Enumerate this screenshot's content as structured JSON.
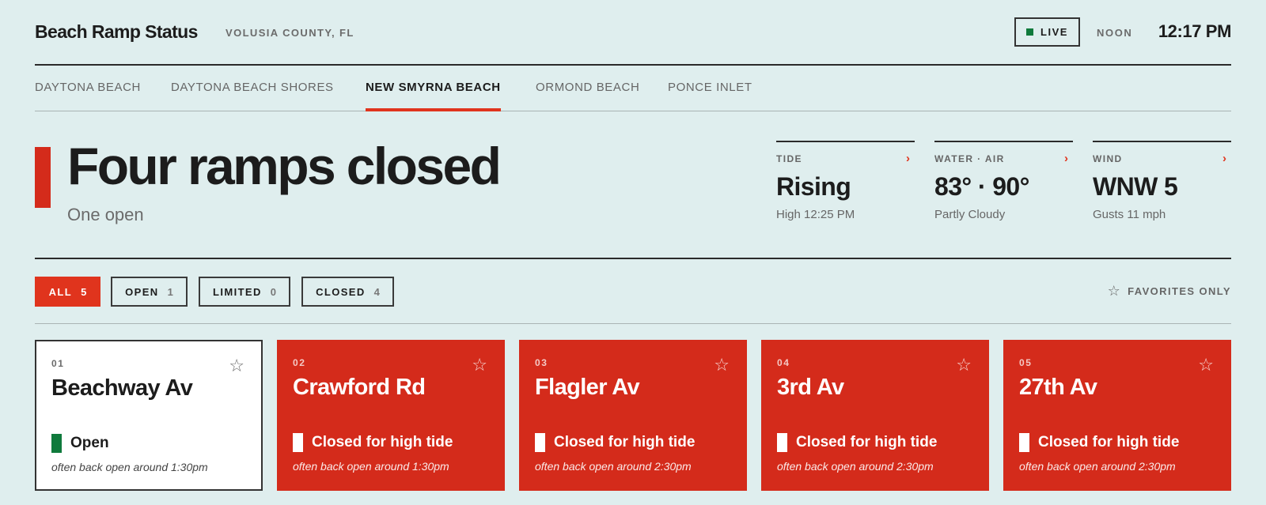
{
  "header": {
    "title": "Beach Ramp Status",
    "county": "VOLUSIA COUNTY, FL",
    "live_label": "LIVE",
    "period": "NOON",
    "time": "12:17 PM"
  },
  "tabs": [
    {
      "label": "DAYTONA BEACH"
    },
    {
      "label": "DAYTONA BEACH SHORES"
    },
    {
      "label": "NEW SMYRNA BEACH",
      "active": true
    },
    {
      "label": "ORMOND BEACH"
    },
    {
      "label": "PONCE INLET"
    }
  ],
  "summary": {
    "headline": "Four ramps closed",
    "subline": "One open"
  },
  "stats": [
    {
      "label": "TIDE",
      "value": "Rising",
      "sub": "High 12:25 PM"
    },
    {
      "label": "WATER · AIR",
      "value": "83° · 90°",
      "sub": "Partly Cloudy"
    },
    {
      "label": "WIND",
      "value": "WNW 5",
      "sub": "Gusts 11 mph"
    }
  ],
  "filters": [
    {
      "label": "ALL",
      "count": "5",
      "active": true
    },
    {
      "label": "OPEN",
      "count": "1"
    },
    {
      "label": "LIMITED",
      "count": "0"
    },
    {
      "label": "CLOSED",
      "count": "4"
    }
  ],
  "favorites_label": "FAVORITES ONLY",
  "ramps": [
    {
      "num": "01",
      "name": "Beachway Av",
      "status": "Open",
      "note": "often back open around 1:30pm",
      "state": "open"
    },
    {
      "num": "02",
      "name": "Crawford Rd",
      "status": "Closed for high tide",
      "note": "often back open around 1:30pm",
      "state": "closed"
    },
    {
      "num": "03",
      "name": "Flagler Av",
      "status": "Closed for high tide",
      "note": "often back open around 2:30pm",
      "state": "closed"
    },
    {
      "num": "04",
      "name": "3rd Av",
      "status": "Closed for high tide",
      "note": "often back open around 2:30pm",
      "state": "closed"
    },
    {
      "num": "05",
      "name": "27th Av",
      "status": "Closed for high tide",
      "note": "often back open around 2:30pm",
      "state": "closed"
    }
  ],
  "icons": {
    "live_dot": "live-indicator-icon",
    "chevron": "chevron-right-icon",
    "star": "star-outline-icon"
  },
  "colors": {
    "accent_red": "#e0341d",
    "closed_card": "#d42b1b",
    "open_green": "#0f7a3c",
    "background": "#dfeeee"
  }
}
